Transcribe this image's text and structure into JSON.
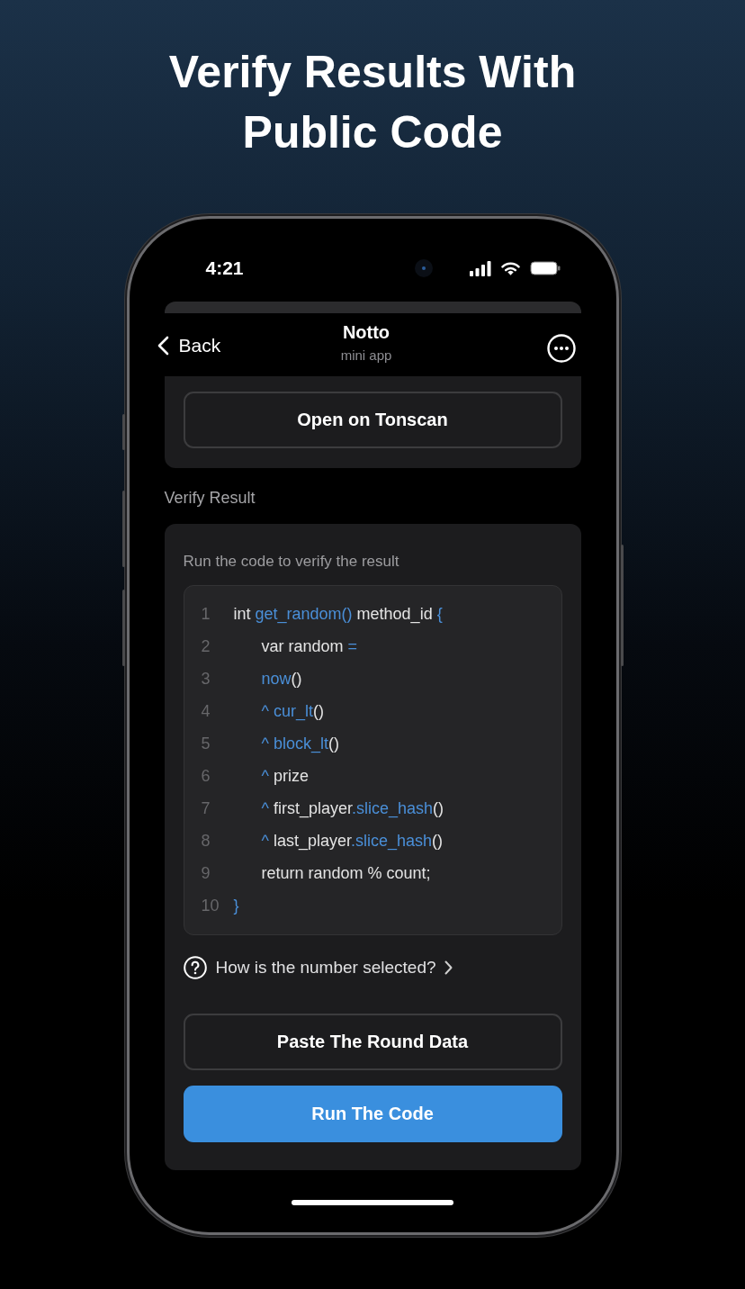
{
  "headline": "Verify Results With Public Code",
  "status_bar": {
    "time": "4:21"
  },
  "header": {
    "back": "Back",
    "title": "Notto",
    "subtitle": "mini app"
  },
  "top_card": {
    "button": "Open on Tonscan"
  },
  "section_label": "Verify Result",
  "verify_card": {
    "instruction": "Run the code to verify the result",
    "code": {
      "lines": [
        {
          "number": "1",
          "tokens": [
            {
              "text": "int ",
              "kind": "plain"
            },
            {
              "text": "get_random()",
              "kind": "highlight"
            },
            {
              "text": " method_id ",
              "kind": "plain"
            },
            {
              "text": "{",
              "kind": "highlight"
            }
          ],
          "children": [
            {
              "number": "2",
              "tokens": [
                {
                  "text": "var random ",
                  "kind": "plain"
                },
                {
                  "text": "=",
                  "kind": "highlight"
                }
              ]
            },
            {
              "number": "3",
              "tokens": [
                {
                  "text": "now",
                  "kind": "highlight"
                },
                {
                  "text": "()",
                  "kind": "plain"
                }
              ]
            },
            {
              "number": "4",
              "tokens": [
                {
                  "text": "^ cur_lt",
                  "kind": "highlight"
                },
                {
                  "text": "()",
                  "kind": "plain"
                }
              ]
            },
            {
              "number": "5",
              "tokens": [
                {
                  "text": "^ block_lt",
                  "kind": "highlight"
                },
                {
                  "text": "()",
                  "kind": "plain"
                }
              ]
            },
            {
              "number": "6",
              "tokens": [
                {
                  "text": "^ ",
                  "kind": "highlight"
                },
                {
                  "text": "prize",
                  "kind": "plain"
                }
              ]
            },
            {
              "number": "7",
              "tokens": [
                {
                  "text": "^ ",
                  "kind": "highlight"
                },
                {
                  "text": "first_player",
                  "kind": "plain"
                },
                {
                  "text": ".slice_hash",
                  "kind": "highlight"
                },
                {
                  "text": "()",
                  "kind": "plain"
                }
              ]
            },
            {
              "number": "8",
              "tokens": [
                {
                  "text": "^ ",
                  "kind": "highlight"
                },
                {
                  "text": "last_player",
                  "kind": "plain"
                },
                {
                  "text": ".slice_hash",
                  "kind": "highlight"
                },
                {
                  "text": "()",
                  "kind": "plain"
                }
              ]
            },
            {
              "number": "9",
              "tokens": [
                {
                  "text": "return random % count;",
                  "kind": "plain"
                }
              ]
            }
          ]
        },
        {
          "number": "10",
          "tokens": [
            {
              "text": "}",
              "kind": "highlight"
            }
          ]
        }
      ]
    },
    "help_link": "How is the number selected?",
    "buttons": [
      {
        "label": "Paste The Round Data",
        "kind": "outline"
      },
      {
        "label": "Run The Code",
        "kind": "primary"
      }
    ]
  }
}
